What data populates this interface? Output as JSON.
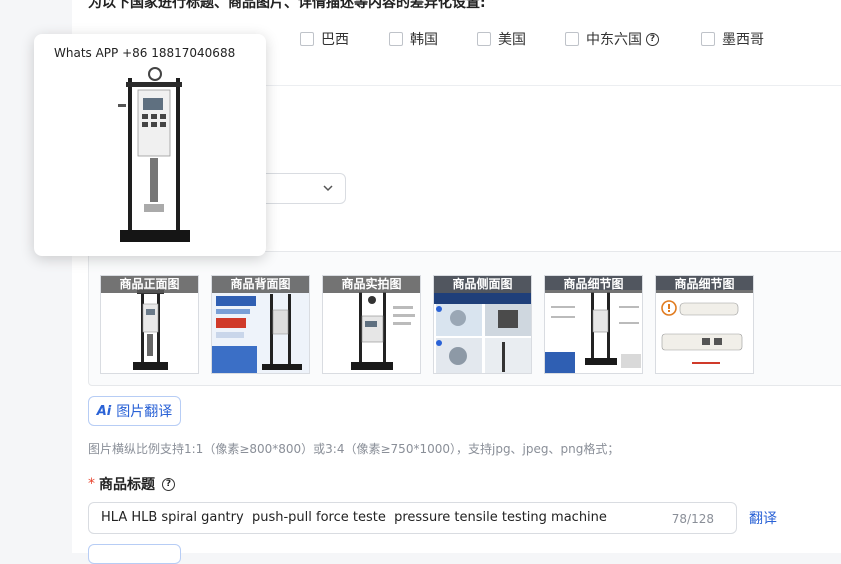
{
  "countries": {
    "heading": "为以下国家进行标题、商品图片、详情描述等内容的差异化设置:",
    "items": [
      {
        "label": "巴西",
        "checked": false
      },
      {
        "label": "韩国",
        "checked": false
      },
      {
        "label": "美国",
        "checked": false
      },
      {
        "label": "中东六国",
        "checked": false
      },
      {
        "label": "墨西哥",
        "checked": false
      }
    ]
  },
  "popup": {
    "caption": "Whats APP +86 18817040688"
  },
  "images": {
    "thumbnails": [
      {
        "label": "商品正面图"
      },
      {
        "label": "商品背面图"
      },
      {
        "label": "商品实拍图"
      },
      {
        "label": "商品侧面图"
      },
      {
        "label": "商品细节图"
      },
      {
        "label": "商品细节图"
      }
    ],
    "ai_button_mark": "Ai",
    "ai_button_label": "图片翻译",
    "hint": "图片横纵比例支持1:1（像素≥800*800）或3:4（像素≥750*1000），支持jpg、jpeg、png格式；"
  },
  "product_title": {
    "required_mark": "*",
    "label": "商品标题",
    "value": "HLA HLB spiral gantry  push-pull force teste  pressure tensile testing machine",
    "count": "78/128",
    "translate_label": "翻译"
  },
  "colors": {
    "accent": "#2a62d6",
    "required": "#e8432e",
    "border": "#d9dce1"
  }
}
